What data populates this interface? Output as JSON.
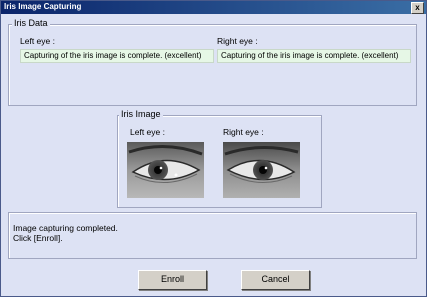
{
  "window": {
    "title": "Iris Image Capturing",
    "close_glyph": "x"
  },
  "iris_data": {
    "legend": "Iris Data",
    "left_label": "Left eye :",
    "left_status": "Capturing of the iris image is complete. (excellent)",
    "right_label": "Right eye :",
    "right_status": "Capturing of the iris image is complete. (excellent)"
  },
  "iris_image": {
    "legend": "Iris Image",
    "left_label": "Left eye :",
    "right_label": "Right eye :"
  },
  "message": {
    "line1": "Image capturing completed.",
    "line2": "Click [Enroll]."
  },
  "buttons": {
    "enroll": "Enroll",
    "cancel": "Cancel"
  }
}
